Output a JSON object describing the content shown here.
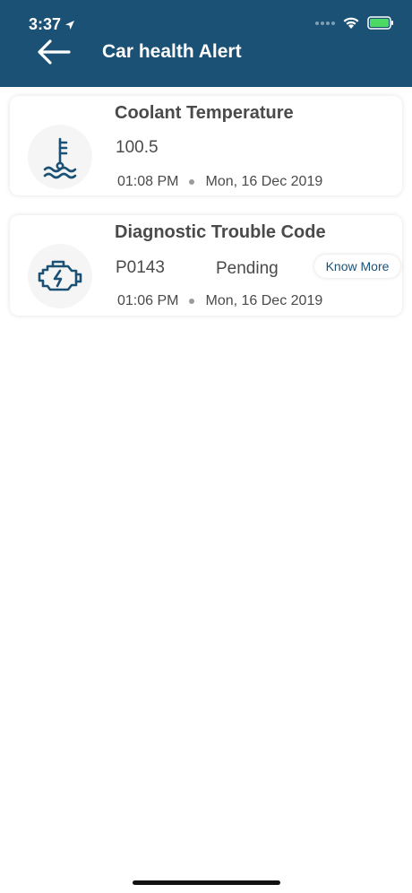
{
  "status_bar": {
    "time": "3:37"
  },
  "header": {
    "title": "Car health Alert"
  },
  "alerts": [
    {
      "title": "Coolant Temperature",
      "value": "100.5",
      "time": "01:08 PM",
      "date": "Mon, 16 Dec 2019",
      "icon": "coolant-temperature-icon"
    },
    {
      "title": "Diagnostic Trouble Code",
      "value": "P0143",
      "status": "Pending",
      "action": "Know More",
      "time": "01:06 PM",
      "date": "Mon, 16 Dec 2019",
      "icon": "engine-check-icon"
    }
  ],
  "colors": {
    "header_bg": "#1b5174",
    "accent": "#1b5174",
    "battery": "#4cd964"
  }
}
